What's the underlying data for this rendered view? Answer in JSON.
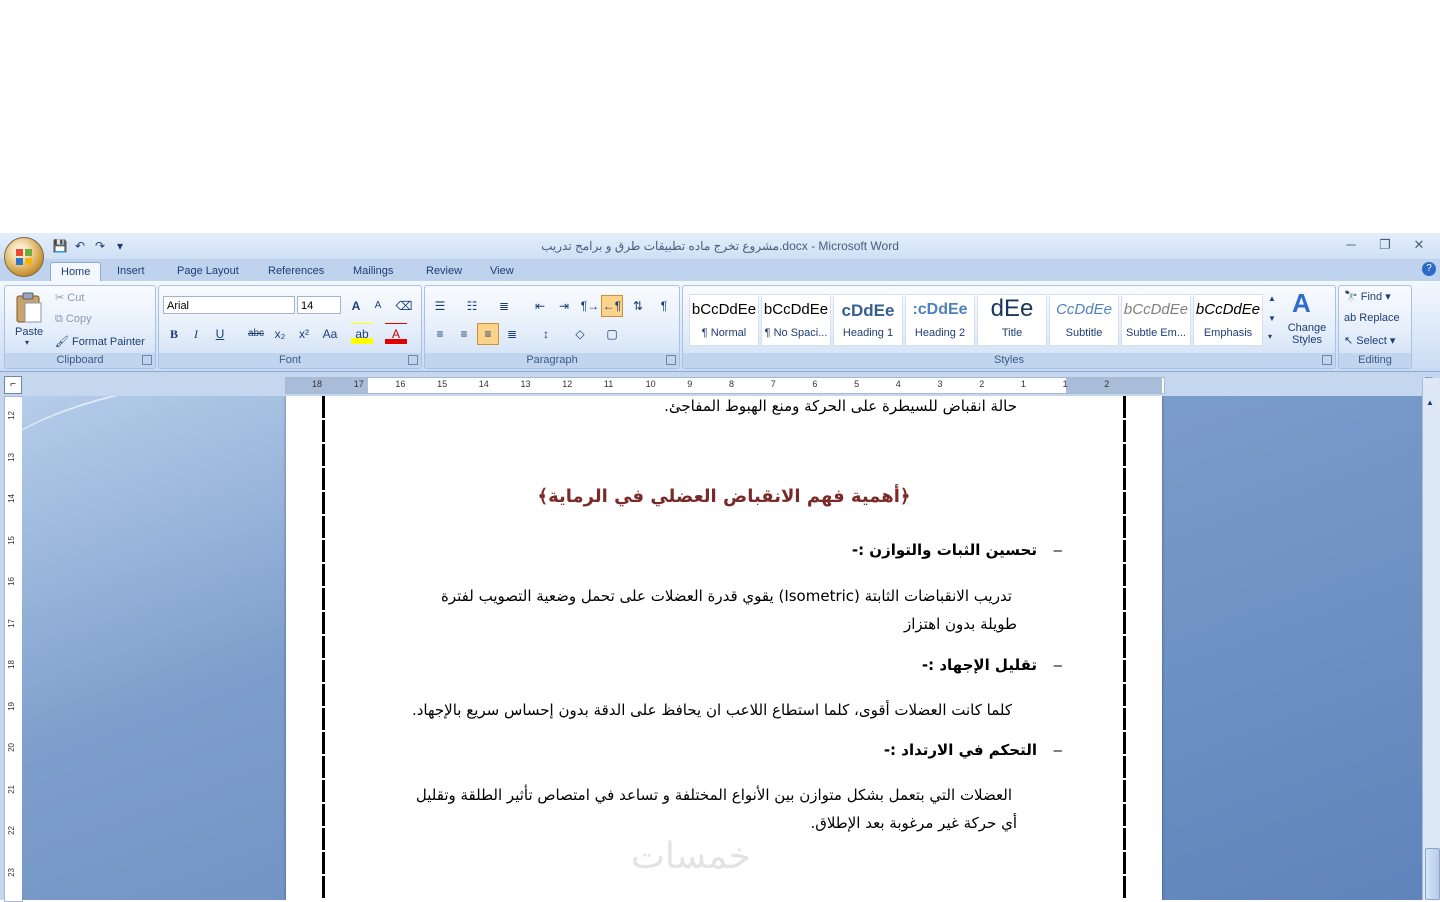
{
  "window": {
    "title": "مشروع تخرج ماده تطبيقات طرق و برامج تدريب.docx - Microsoft Word",
    "controls": [
      "─",
      "❐",
      "✕"
    ]
  },
  "quick_access": [
    "💾",
    "↶",
    "↷",
    "▾"
  ],
  "tabs": [
    "Home",
    "Insert",
    "Page Layout",
    "References",
    "Mailings",
    "Review",
    "View"
  ],
  "clipboard": {
    "paste": "Paste",
    "cut": "Cut",
    "copy": "Copy",
    "format_painter": "Format Painter",
    "label": "Clipboard"
  },
  "font": {
    "name": "Arial",
    "size": "14",
    "label": "Font"
  },
  "paragraph": {
    "label": "Paragraph"
  },
  "styles": {
    "items": [
      {
        "sample": "bCcDdEe",
        "name": "¶ Normal"
      },
      {
        "sample": "bCcDdEe",
        "name": "¶ No Spaci..."
      },
      {
        "sample": "cDdEe",
        "name": "Heading 1"
      },
      {
        "sample": ":cDdEe",
        "name": "Heading 2"
      },
      {
        "sample": "dEe",
        "name": "Title"
      },
      {
        "sample": "CcDdEe",
        "name": "Subtitle"
      },
      {
        "sample": "bCcDdEe",
        "name": "Subtle Em..."
      },
      {
        "sample": "bCcDdEe",
        "name": "Emphasis"
      }
    ],
    "change_styles": "Change Styles",
    "label": "Styles"
  },
  "editing": {
    "find": "Find",
    "replace": "Replace",
    "select": "Select",
    "label": "Editing"
  },
  "ruler_numbers": [
    "18",
    "17",
    "16",
    "15",
    "14",
    "13",
    "12",
    "11",
    "10",
    "9",
    "8",
    "7",
    "6",
    "5",
    "4",
    "3",
    "2",
    "1",
    "1",
    "2"
  ],
  "vruler_numbers": [
    "12",
    "13",
    "14",
    "15",
    "16",
    "17",
    "18",
    "19",
    "20",
    "21",
    "22",
    "23"
  ],
  "document": {
    "line_top": "حالة انقباض للسيطرة على الحركة ومنع الهبوط المفاجئ.",
    "heading": "﴿أهمية فهم الانقباض العضلي في الرماية﴾",
    "bullet1": "تحسين الثبات والتوازن :-",
    "para1_line1": "تدريب الانقباضات الثابتة (Isometric) يقوي قدرة العضلات على تحمل وضعية التصويب لفترة",
    "para1_line2": "طويلة بدون اهتزاز",
    "bullet2": "تقليل الإجهاد :-",
    "para2": "كلما كانت العضلات أقوى، كلما استطاع اللاعب ان يحافظ على الدقة بدون إحساس سريع بالإجهاد.",
    "bullet3": "التحكم في الارتداد :-",
    "para3_line1": "العضلات التي بتعمل بشكل متوازن بين الأنواع المختلفة و تساعد في امتصاص تأثير الطلقة وتقليل",
    "para3_line2": "أي حركة غير مرغوبة بعد الإطلاق.",
    "watermark": "خمسات"
  }
}
